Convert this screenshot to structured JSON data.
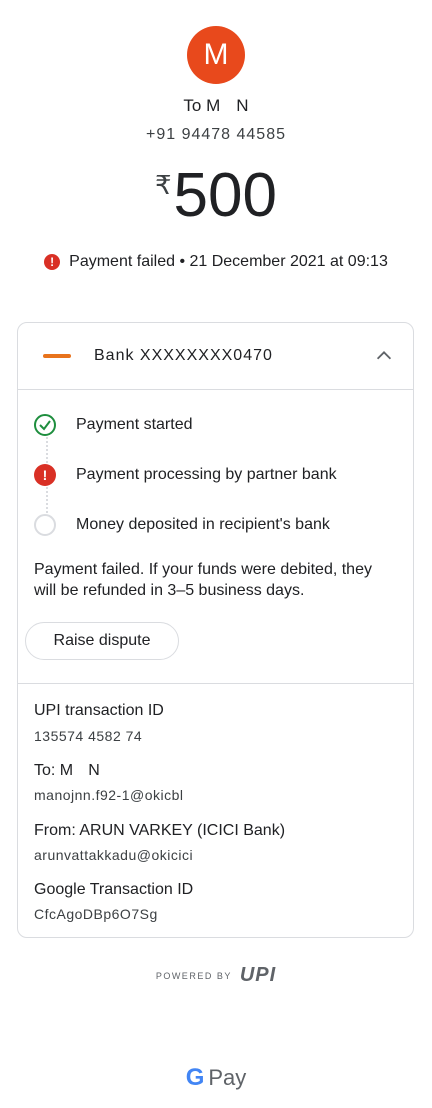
{
  "avatar": {
    "initial": "M",
    "color": "#e8491c"
  },
  "recipient": {
    "to_line": "To M     N",
    "phone": "+91 94478 44585"
  },
  "amount": {
    "currency": "₹",
    "value": "500"
  },
  "status": {
    "icon": "error-icon",
    "text": "Payment failed • 21 December 2021 at 09:13"
  },
  "bank": {
    "name": "Bank XXXXXXXX0470",
    "chevron": "chevron-up-icon"
  },
  "steps": [
    {
      "label": "Payment started",
      "state": "done"
    },
    {
      "label": "Payment processing by partner bank",
      "state": "error"
    },
    {
      "label": "Money deposited in recipient's bank",
      "state": "pending"
    }
  ],
  "failure_message": "Payment failed. If your funds were debited, they will be refunded in 3–5 business days.",
  "dispute_button": "Raise dispute",
  "details": {
    "upi_label": "UPI transaction ID",
    "upi_value": "135574 4582 74",
    "to_label": "To: M     N",
    "to_value": "manojnn.f92-1@okicbl",
    "from_label": "From: ARUN VARKEY (ICICI Bank)",
    "from_value": "arunvattakkadu@okicici",
    "google_label": "Google Transaction ID",
    "google_value": "CfcAgoDBp6O7Sg"
  },
  "footer": {
    "powered_by": "POWERED BY",
    "upi_logo": "UPI",
    "brand": "Pay",
    "brand_g": "G"
  },
  "colors": {
    "success": "#1e8e3e",
    "error": "#d93025",
    "border": "#dadce0",
    "avatar": "#e8491c"
  }
}
